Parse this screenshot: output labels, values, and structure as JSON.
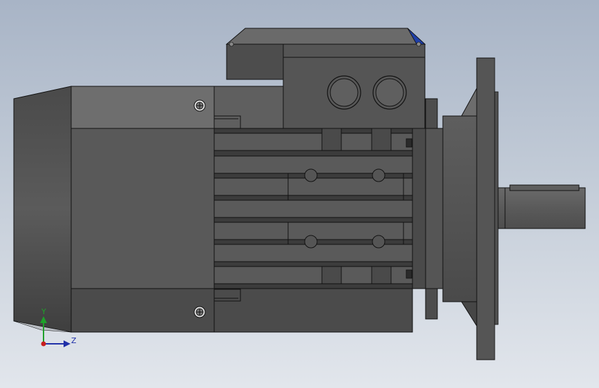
{
  "viewport": {
    "background_top": "#a8b4c6",
    "background_bottom": "#e2e6ec"
  },
  "model": {
    "description_icon": "motor-3d-model-icon",
    "body_color": "#595959",
    "body_light": "#6e6e6e",
    "body_dark": "#3c3c3c",
    "edge_color": "#111111",
    "accent_color": "#1f3fa8"
  },
  "triad": {
    "y_label": "Y",
    "z_label": "Z",
    "y_color": "#1fa02a",
    "z_color": "#1f2fa8",
    "origin_color": "#c81e1e"
  }
}
